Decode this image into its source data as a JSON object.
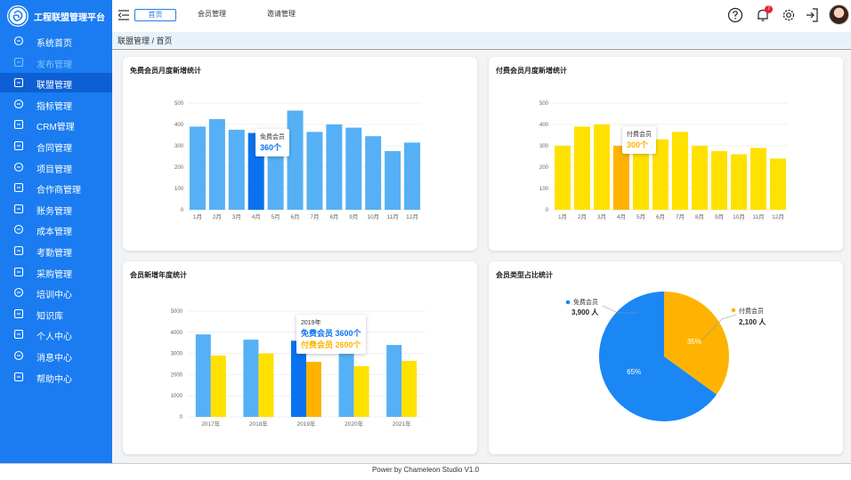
{
  "app": {
    "title": "工程联盟管理平台"
  },
  "sidebar": {
    "items": [
      {
        "label": "系统首页",
        "icon": "home-icon"
      },
      {
        "label": "发布管理",
        "icon": "rocket-icon"
      },
      {
        "label": "联盟管理",
        "icon": "network-icon"
      },
      {
        "label": "指标管理",
        "icon": "chart-line-icon"
      },
      {
        "label": "CRM管理",
        "icon": "server-icon"
      },
      {
        "label": "合同管理",
        "icon": "contract-icon"
      },
      {
        "label": "项目管理",
        "icon": "project-icon"
      },
      {
        "label": "合作商管理",
        "icon": "partner-icon"
      },
      {
        "label": "账务管理",
        "icon": "finance-icon"
      },
      {
        "label": "成本管理",
        "icon": "cost-icon"
      },
      {
        "label": "考勤管理",
        "icon": "attendance-icon"
      },
      {
        "label": "采购管理",
        "icon": "purchase-icon"
      },
      {
        "label": "培训中心",
        "icon": "training-icon"
      },
      {
        "label": "知识库",
        "icon": "knowledge-icon"
      },
      {
        "label": "个人中心",
        "icon": "user-icon"
      },
      {
        "label": "消息中心",
        "icon": "message-icon"
      },
      {
        "label": "帮助中心",
        "icon": "info-icon"
      }
    ]
  },
  "topbar": {
    "tabs": [
      "首页",
      "会员管理",
      "邀请管理"
    ],
    "notification_count": "7"
  },
  "breadcrumb": "联盟管理 / 首页",
  "footer": "Power by Chameleon Studio V1.0",
  "colors": {
    "sidebar": "#1a7cf0",
    "blue": "#55b0f6",
    "blue_highlight": "#0a72f0",
    "yellow": "#ffe100",
    "yellow_highlight": "#ffb300"
  },
  "chart_data": [
    {
      "type": "bar",
      "title": "免费会员月度新增统计",
      "categories": [
        "1月",
        "2月",
        "3月",
        "4月",
        "5月",
        "6月",
        "7月",
        "8月",
        "9月",
        "10月",
        "11月",
        "12月"
      ],
      "series": [
        {
          "name": "免费会员",
          "values": [
            390,
            425,
            375,
            360,
            345,
            465,
            365,
            400,
            385,
            345,
            275,
            315
          ]
        }
      ],
      "ylim": [
        0,
        500
      ],
      "yticks": [
        0,
        100,
        200,
        300,
        400,
        500
      ],
      "highlight_index": 3,
      "tooltip": {
        "label": "免费会员",
        "value": "360个"
      }
    },
    {
      "type": "bar",
      "title": "付费会员月度新增统计",
      "categories": [
        "1月",
        "2月",
        "3月",
        "4月",
        "5月",
        "6月",
        "7月",
        "8月",
        "9月",
        "10月",
        "11月",
        "12月"
      ],
      "series": [
        {
          "name": "付费会员",
          "values": [
            300,
            390,
            400,
            300,
            340,
            330,
            365,
            300,
            275,
            260,
            290,
            240
          ]
        }
      ],
      "ylim": [
        0,
        500
      ],
      "yticks": [
        0,
        100,
        200,
        300,
        400,
        500
      ],
      "highlight_index": 3,
      "tooltip": {
        "label": "付费会员",
        "value": "300个"
      }
    },
    {
      "type": "bar",
      "title": "会员新增年度统计",
      "categories": [
        "2017年",
        "2018年",
        "2019年",
        "2020年",
        "2021年"
      ],
      "series": [
        {
          "name": "免费会员",
          "values": [
            3900,
            3650,
            3600,
            3300,
            3400
          ]
        },
        {
          "name": "付费会员",
          "values": [
            2900,
            3000,
            2600,
            2400,
            2650
          ]
        }
      ],
      "ylim": [
        0,
        5000
      ],
      "yticks": [
        0,
        1000,
        2000,
        3000,
        4000,
        5000
      ],
      "highlight_index": 2,
      "tooltip": {
        "label": "2019年",
        "line1": "免费会员 3600个",
        "line2": "付费会员 2600个"
      }
    },
    {
      "type": "pie",
      "title": "会员类型占比统计",
      "slices": [
        {
          "name": "免费会员",
          "value": 3900,
          "value_label": "3,900 人",
          "percent_label": "65%"
        },
        {
          "name": "付费会员",
          "value": 2100,
          "value_label": "2,100 人",
          "percent_label": "35%"
        }
      ]
    }
  ]
}
